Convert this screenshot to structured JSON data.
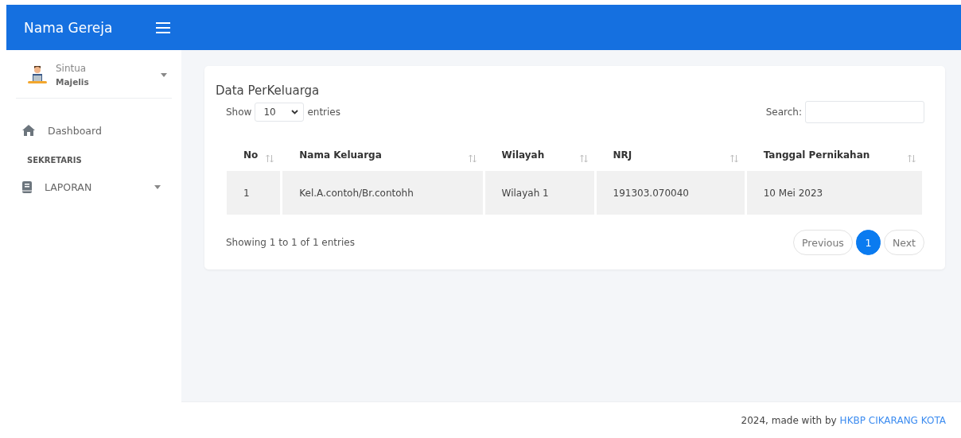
{
  "brand": "Nama Gereja",
  "user": {
    "name": "Sintua",
    "role": "Majelis"
  },
  "nav": [
    {
      "kind": "link",
      "label": "Dashboard"
    },
    {
      "kind": "heading",
      "label": "SEKRETARIS"
    },
    {
      "kind": "dropdown",
      "label": "LAPORAN"
    }
  ],
  "card": {
    "title": "Data PerKeluarga",
    "show_label": "Show",
    "page_size": "10",
    "entries_label": "entries",
    "search_label": "Search:",
    "columns": [
      "No",
      "Nama Keluarga",
      "Wilayah",
      "NRJ",
      "Tanggal Pernikahan"
    ],
    "rows": [
      [
        "1",
        "Kel.A.contoh/Br.contohh",
        "Wilayah 1",
        "191303.070040",
        "10 Mei 2023"
      ]
    ],
    "info": "Showing 1 to 1 of 1 entries",
    "pagination": [
      {
        "label": "Previous",
        "kind": "nav",
        "selected": false
      },
      {
        "label": "1",
        "kind": "page",
        "selected": true
      },
      {
        "label": "Next",
        "kind": "nav",
        "selected": false
      }
    ]
  },
  "footer": {
    "text": "2024, made with by",
    "link": "HKBP CIKARANG KOTA"
  }
}
